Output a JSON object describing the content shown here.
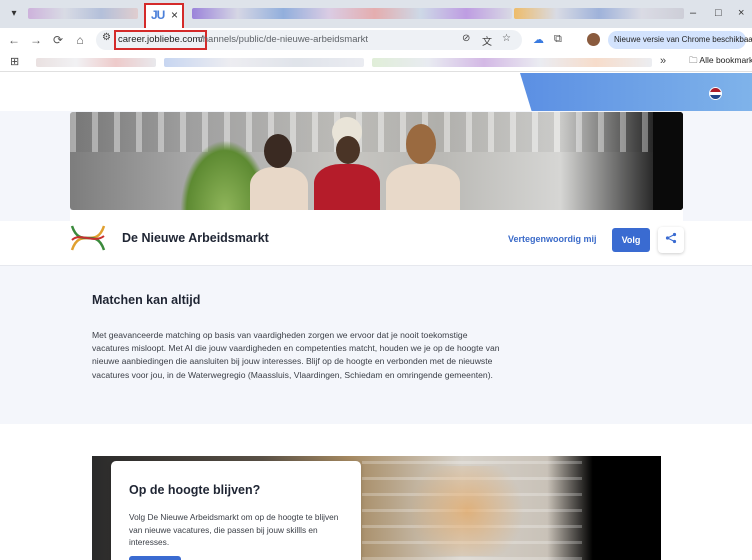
{
  "browser": {
    "active_tab": {
      "favicon_text": "JU",
      "close_label": "×"
    },
    "window_controls": {
      "minimize": "–",
      "maximize": "□",
      "close": "×"
    },
    "nav": {
      "back": "←",
      "forward": "→",
      "reload": "⟳",
      "home": "⌂"
    },
    "address_bar": {
      "url_domain": "career.jobliebe.com/",
      "url_path": "channels/public/de-nieuwe-arbeidsmarkt"
    },
    "update_button_label": "Nieuwe versie van Chrome beschikbaar",
    "bookmarks": {
      "more": "»",
      "folder_label": "Alle bookmarks"
    }
  },
  "page": {
    "company": {
      "name": "De Nieuwe Arbeidsmarkt"
    },
    "actions": {
      "represent_label": "Vertegenwoordig mij",
      "follow_label": "Volg",
      "share_icon": "share-icon"
    },
    "about": {
      "title": "Matchen kan altijd",
      "body": "Met geavanceerde matching op basis van vaardigheden zorgen we ervoor dat je nooit toekomstige vacatures misloopt. Met AI die jouw vaardigheden en competenties matcht, houden we je op de hoogte van nieuwe aanbiedingen die aansluiten bij jouw interesses. Blijf op de hoogte en verbonden met de nieuwste vacatures voor jou, in de Waterwegregio (Maassluis, Vlaardingen, Schiedam en omringende gemeenten)."
    },
    "stay_updated": {
      "title": "Op de hoogte blijven?",
      "body": "Volg De Nieuwe Arbeidsmarkt om op de hoogte te blijven van nieuwe vacatures, die passen bij jouw skillls en interesses."
    }
  },
  "colors": {
    "primary": "#3a6bd1",
    "highlight": "#d42a2a",
    "light_section": "#f4f6fb"
  }
}
